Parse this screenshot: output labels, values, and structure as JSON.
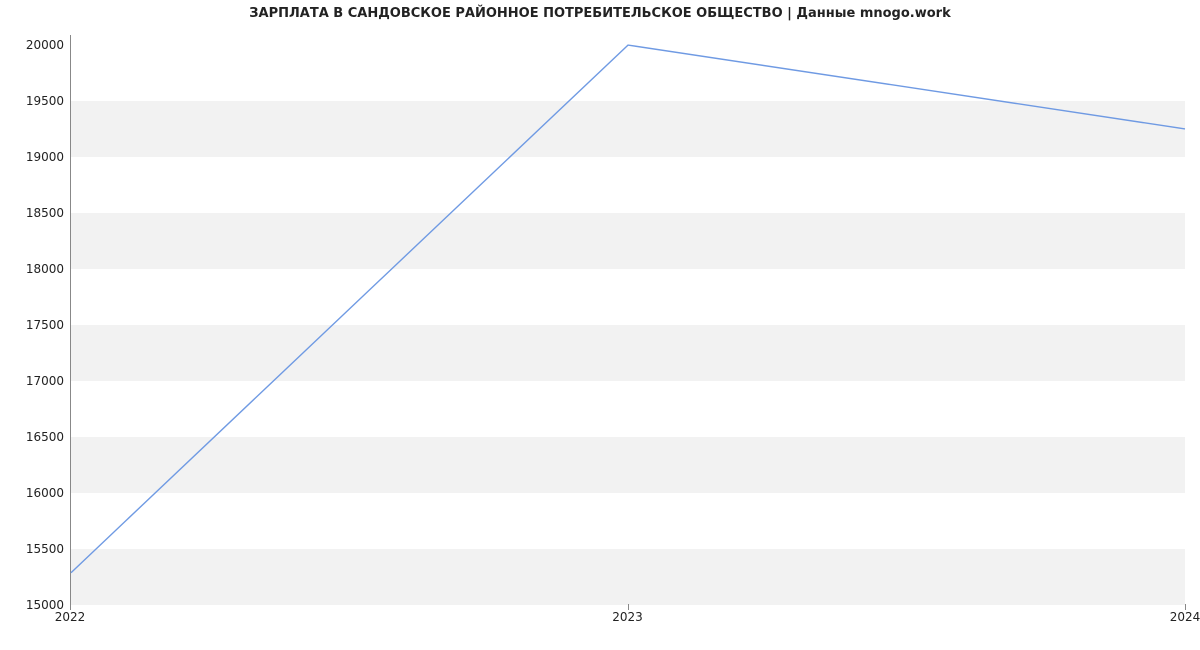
{
  "chart_data": {
    "type": "line",
    "title": "ЗАРПЛАТА В САНДОВСКОЕ РАЙОННОЕ ПОТРЕБИТЕЛЬСКОЕ ОБЩЕСТВО | Данные mnogo.work",
    "xlabel": "",
    "ylabel": "",
    "x_categories": [
      "2022",
      "2023",
      "2024"
    ],
    "x_numeric": [
      2022,
      2023,
      2024
    ],
    "series": [
      {
        "name": "salary",
        "values": [
          15280,
          20000,
          19250
        ]
      }
    ],
    "y_ticks": [
      15000,
      15500,
      16000,
      16500,
      17000,
      17500,
      18000,
      18500,
      19000,
      19500,
      20000
    ],
    "ylim": [
      15000,
      20090
    ],
    "xlim": [
      2022,
      2024
    ],
    "grid": "horizontal-bands",
    "legend": false,
    "colors": {
      "line": "#6f9ae3",
      "band": "#f2f2f2",
      "axis": "#888888"
    }
  }
}
